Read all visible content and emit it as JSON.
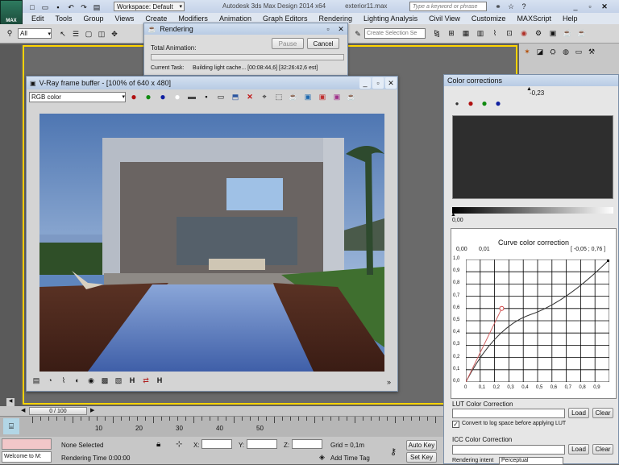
{
  "app": {
    "title": "Autodesk 3ds Max Design 2014 x64",
    "file": "exterior11.max",
    "workspace": "Workspace: Default",
    "help_search_placeholder": "Type a keyword or phrase",
    "logo_label": "MAX"
  },
  "menu": [
    "Edit",
    "Tools",
    "Group",
    "Views",
    "Create",
    "Modifiers",
    "Animation",
    "Graph Editors",
    "Rendering",
    "Lighting Analysis",
    "Civil View",
    "Customize",
    "MAXScript",
    "Help"
  ],
  "toolbar": {
    "filter_value": "All",
    "selection_set_placeholder": "Create Selection Se"
  },
  "rendering_dialog": {
    "title": "Rendering",
    "pause_label": "Pause",
    "cancel_label": "Cancel",
    "total_animation_label": "Total Animation:",
    "current_task_label": "Current Task:",
    "current_task_value": "Building light cache... [00:08:44,6] [32:26:42,6 est]",
    "progress": 0.0
  },
  "vray": {
    "title": "V-Ray frame buffer - [100% of 640 x 480]",
    "channel": "RGB color",
    "bottom_icons": [
      "H",
      "H"
    ]
  },
  "color_corrections": {
    "title": "Color corrections",
    "exposure_value": "-0,23",
    "level_value": "0,00",
    "curve": {
      "title": "Curve color correction",
      "input_a": "0,00",
      "input_b": "0,01",
      "coord_readout": "[ -0,05 ; 0,76 ]",
      "y_ticks": [
        "1,0",
        "0,9",
        "0,8",
        "0,7",
        "0,6",
        "0,5",
        "0,4",
        "0,3",
        "0,2",
        "0,1",
        "0,0"
      ],
      "x_ticks": [
        "0",
        "0,1",
        "0,2",
        "0,3",
        "0,4",
        "0,5",
        "0,6",
        "0,7",
        "0,8",
        "0,9"
      ]
    },
    "lut_label": "LUT Color Correction",
    "load_label": "Load",
    "clear_label": "Clear",
    "convert_label": "Convert to log space before applying LUT",
    "convert_checked": true,
    "icc_label": "ICC Color Correction",
    "rendering_intent_label": "Rendering intent",
    "rendering_intent_value": "Perceptual"
  },
  "timeline": {
    "frame_readout": "0 / 100",
    "ticks": [
      "10",
      "20",
      "30",
      "40",
      "50"
    ]
  },
  "status": {
    "welcome": "Welcome to M:",
    "selection": "None Selected",
    "rendering_time": "Rendering Time  0:00:00",
    "x_label": "X:",
    "y_label": "Y:",
    "z_label": "Z:",
    "grid": "Grid = 0,1m",
    "add_time_tag": "Add Time Tag",
    "auto_key": "Auto Key",
    "set_key": "Set Key",
    "selected_value": "Selected"
  },
  "colors": {
    "accent_blue": "#1e3f8f",
    "title_bar": "#c9d7ea",
    "viewport_border": "#ffd400",
    "sky": "#5f86bd",
    "grass": "#3f6f2f"
  }
}
